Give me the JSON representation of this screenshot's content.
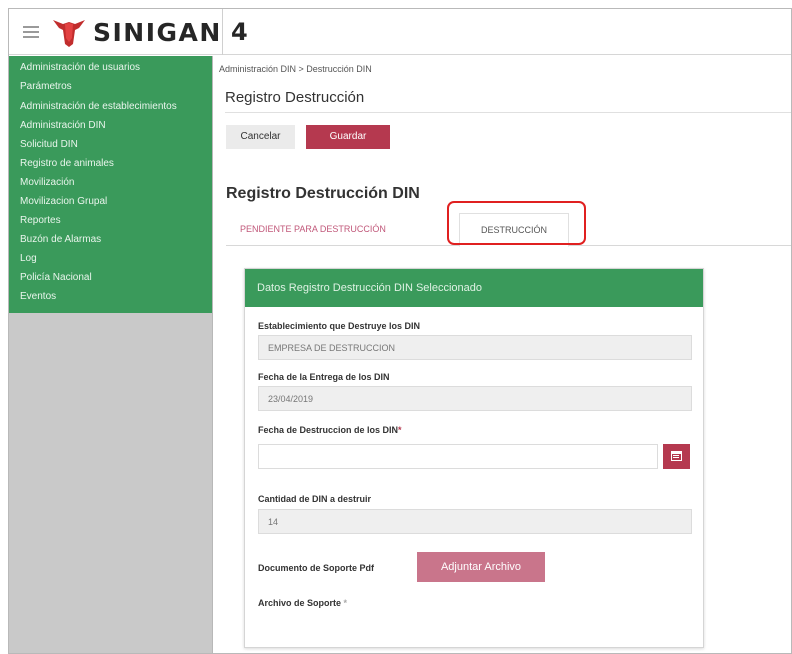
{
  "app": {
    "brand": "SINIGAN",
    "version": "4"
  },
  "sidebar": {
    "items": [
      {
        "label": "Administración de usuarios"
      },
      {
        "label": "Parámetros"
      },
      {
        "label": "Administración de establecimientos"
      },
      {
        "label": "Administración DIN"
      },
      {
        "label": "Solicitud DIN"
      },
      {
        "label": "Registro de animales"
      },
      {
        "label": "Movilización"
      },
      {
        "label": "Movilizacion Grupal"
      },
      {
        "label": "Reportes"
      },
      {
        "label": "Buzón de Alarmas"
      },
      {
        "label": "Log"
      },
      {
        "label": "Policía Nacional"
      },
      {
        "label": "Eventos"
      }
    ]
  },
  "main": {
    "breadcrumb": "Administración DIN > Destrucción DIN",
    "page_title": "Registro Destrucción",
    "buttons": {
      "cancel": "Cancelar",
      "save": "Guardar"
    },
    "section_title": "Registro Destrucción DIN",
    "tabs": [
      {
        "label": "PENDIENTE PARA DESTRUCCIÓN"
      },
      {
        "label": "DESTRUCCIÓN",
        "active": true
      }
    ],
    "panel": {
      "header": "Datos Registro Destrucción DIN Seleccionado",
      "fields": {
        "establishment": {
          "label": "Establecimiento que Destruye los DIN",
          "value": "EMPRESA DE DESTRUCCION"
        },
        "delivery_date": {
          "label": "Fecha de la Entrega de los DIN",
          "value": "23/04/2019"
        },
        "destruction_date": {
          "label": "Fecha de Destruccion de los DIN",
          "required_mark": "*",
          "value": ""
        },
        "quantity": {
          "label": "Cantidad de DIN a destruir",
          "value": "14"
        },
        "support_doc": {
          "label": "Documento de Soporte Pdf",
          "button": "Adjuntar Archivo"
        },
        "support_file": {
          "label": "Archivo de Soporte",
          "mark": "*"
        }
      }
    }
  },
  "colors": {
    "green": "#3a9a5b",
    "crimson": "#b5394f",
    "highlight": "#e02020"
  },
  "icons": {
    "menu": "hamburger-icon",
    "logo": "cow-logo-icon",
    "calendar": "calendar-icon"
  }
}
